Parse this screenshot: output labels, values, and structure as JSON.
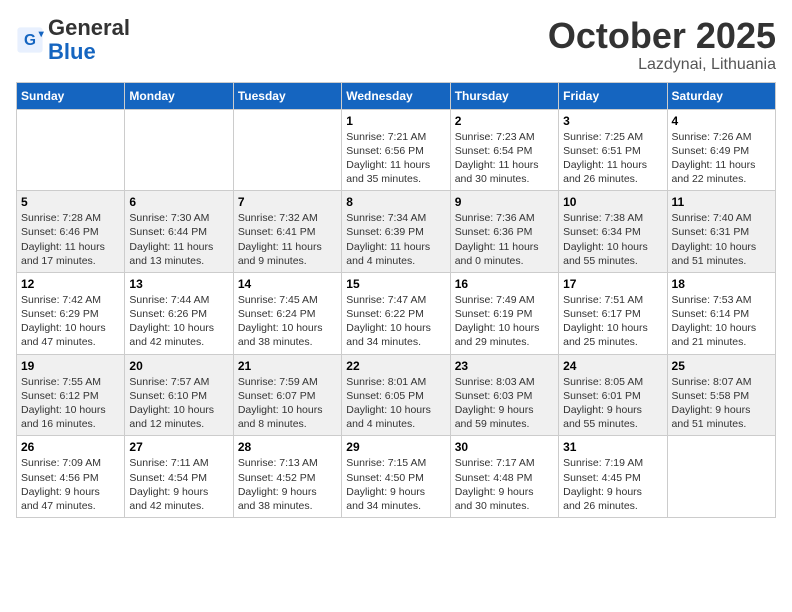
{
  "header": {
    "logo_general": "General",
    "logo_blue": "Blue",
    "month": "October 2025",
    "location": "Lazdynai, Lithuania"
  },
  "weekdays": [
    "Sunday",
    "Monday",
    "Tuesday",
    "Wednesday",
    "Thursday",
    "Friday",
    "Saturday"
  ],
  "weeks": [
    [
      {
        "day": "",
        "info": ""
      },
      {
        "day": "",
        "info": ""
      },
      {
        "day": "",
        "info": ""
      },
      {
        "day": "1",
        "info": "Sunrise: 7:21 AM\nSunset: 6:56 PM\nDaylight: 11 hours\nand 35 minutes."
      },
      {
        "day": "2",
        "info": "Sunrise: 7:23 AM\nSunset: 6:54 PM\nDaylight: 11 hours\nand 30 minutes."
      },
      {
        "day": "3",
        "info": "Sunrise: 7:25 AM\nSunset: 6:51 PM\nDaylight: 11 hours\nand 26 minutes."
      },
      {
        "day": "4",
        "info": "Sunrise: 7:26 AM\nSunset: 6:49 PM\nDaylight: 11 hours\nand 22 minutes."
      }
    ],
    [
      {
        "day": "5",
        "info": "Sunrise: 7:28 AM\nSunset: 6:46 PM\nDaylight: 11 hours\nand 17 minutes."
      },
      {
        "day": "6",
        "info": "Sunrise: 7:30 AM\nSunset: 6:44 PM\nDaylight: 11 hours\nand 13 minutes."
      },
      {
        "day": "7",
        "info": "Sunrise: 7:32 AM\nSunset: 6:41 PM\nDaylight: 11 hours\nand 9 minutes."
      },
      {
        "day": "8",
        "info": "Sunrise: 7:34 AM\nSunset: 6:39 PM\nDaylight: 11 hours\nand 4 minutes."
      },
      {
        "day": "9",
        "info": "Sunrise: 7:36 AM\nSunset: 6:36 PM\nDaylight: 11 hours\nand 0 minutes."
      },
      {
        "day": "10",
        "info": "Sunrise: 7:38 AM\nSunset: 6:34 PM\nDaylight: 10 hours\nand 55 minutes."
      },
      {
        "day": "11",
        "info": "Sunrise: 7:40 AM\nSunset: 6:31 PM\nDaylight: 10 hours\nand 51 minutes."
      }
    ],
    [
      {
        "day": "12",
        "info": "Sunrise: 7:42 AM\nSunset: 6:29 PM\nDaylight: 10 hours\nand 47 minutes."
      },
      {
        "day": "13",
        "info": "Sunrise: 7:44 AM\nSunset: 6:26 PM\nDaylight: 10 hours\nand 42 minutes."
      },
      {
        "day": "14",
        "info": "Sunrise: 7:45 AM\nSunset: 6:24 PM\nDaylight: 10 hours\nand 38 minutes."
      },
      {
        "day": "15",
        "info": "Sunrise: 7:47 AM\nSunset: 6:22 PM\nDaylight: 10 hours\nand 34 minutes."
      },
      {
        "day": "16",
        "info": "Sunrise: 7:49 AM\nSunset: 6:19 PM\nDaylight: 10 hours\nand 29 minutes."
      },
      {
        "day": "17",
        "info": "Sunrise: 7:51 AM\nSunset: 6:17 PM\nDaylight: 10 hours\nand 25 minutes."
      },
      {
        "day": "18",
        "info": "Sunrise: 7:53 AM\nSunset: 6:14 PM\nDaylight: 10 hours\nand 21 minutes."
      }
    ],
    [
      {
        "day": "19",
        "info": "Sunrise: 7:55 AM\nSunset: 6:12 PM\nDaylight: 10 hours\nand 16 minutes."
      },
      {
        "day": "20",
        "info": "Sunrise: 7:57 AM\nSunset: 6:10 PM\nDaylight: 10 hours\nand 12 minutes."
      },
      {
        "day": "21",
        "info": "Sunrise: 7:59 AM\nSunset: 6:07 PM\nDaylight: 10 hours\nand 8 minutes."
      },
      {
        "day": "22",
        "info": "Sunrise: 8:01 AM\nSunset: 6:05 PM\nDaylight: 10 hours\nand 4 minutes."
      },
      {
        "day": "23",
        "info": "Sunrise: 8:03 AM\nSunset: 6:03 PM\nDaylight: 9 hours\nand 59 minutes."
      },
      {
        "day": "24",
        "info": "Sunrise: 8:05 AM\nSunset: 6:01 PM\nDaylight: 9 hours\nand 55 minutes."
      },
      {
        "day": "25",
        "info": "Sunrise: 8:07 AM\nSunset: 5:58 PM\nDaylight: 9 hours\nand 51 minutes."
      }
    ],
    [
      {
        "day": "26",
        "info": "Sunrise: 7:09 AM\nSunset: 4:56 PM\nDaylight: 9 hours\nand 47 minutes."
      },
      {
        "day": "27",
        "info": "Sunrise: 7:11 AM\nSunset: 4:54 PM\nDaylight: 9 hours\nand 42 minutes."
      },
      {
        "day": "28",
        "info": "Sunrise: 7:13 AM\nSunset: 4:52 PM\nDaylight: 9 hours\nand 38 minutes."
      },
      {
        "day": "29",
        "info": "Sunrise: 7:15 AM\nSunset: 4:50 PM\nDaylight: 9 hours\nand 34 minutes."
      },
      {
        "day": "30",
        "info": "Sunrise: 7:17 AM\nSunset: 4:48 PM\nDaylight: 9 hours\nand 30 minutes."
      },
      {
        "day": "31",
        "info": "Sunrise: 7:19 AM\nSunset: 4:45 PM\nDaylight: 9 hours\nand 26 minutes."
      },
      {
        "day": "",
        "info": ""
      }
    ]
  ]
}
